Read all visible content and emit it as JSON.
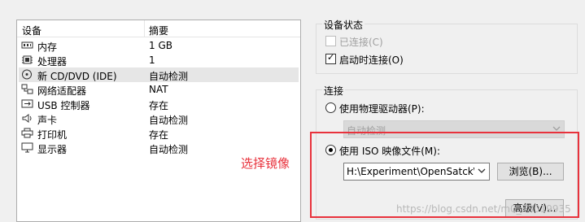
{
  "device_list": {
    "header_device": "设备",
    "header_summary": "摘要",
    "rows": [
      {
        "icon": "memory-icon",
        "name": "内存",
        "summary": "1 GB"
      },
      {
        "icon": "processor-icon",
        "name": "处理器",
        "summary": "1"
      },
      {
        "icon": "cd-dvd-icon",
        "name": "新 CD/DVD (IDE)",
        "summary": "自动检测"
      },
      {
        "icon": "network-adapter-icon",
        "name": "网络适配器",
        "summary": "NAT"
      },
      {
        "icon": "usb-controller-icon",
        "name": "USB 控制器",
        "summary": "存在"
      },
      {
        "icon": "sound-card-icon",
        "name": "声卡",
        "summary": "自动检测"
      },
      {
        "icon": "printer-icon",
        "name": "打印机",
        "summary": "存在"
      },
      {
        "icon": "display-icon",
        "name": "显示器",
        "summary": "自动检测"
      }
    ]
  },
  "device_status": {
    "title": "设备状态",
    "connected_label": "已连接(C)",
    "connected_checked": false,
    "connected_enabled": false,
    "connect_at_power_on_label": "启动时连接(O)",
    "connect_at_power_on_checked": true
  },
  "connection": {
    "title": "连接",
    "physical_drive_label": "使用物理驱动器(P):",
    "physical_drive_value": "自动检测",
    "iso_label": "使用 ISO 映像文件(M):",
    "iso_path": "H:\\Experiment\\OpenSatck\\E",
    "browse_button": "浏览(B)...",
    "advanced_button": "高级(V)...",
    "selected_option": "iso"
  },
  "annotation": {
    "text": "选择镜像",
    "color": "#e8323c"
  },
  "watermark": "https://blog.csdn.net/m0_38019935"
}
